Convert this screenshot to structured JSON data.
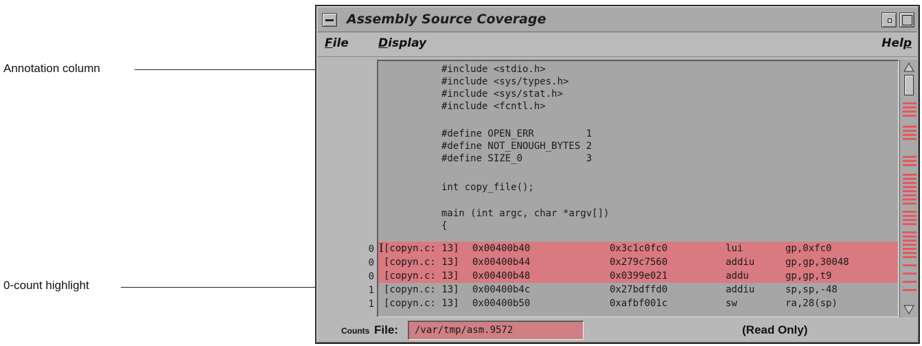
{
  "callouts": {
    "annotation_column": "Annotation column",
    "zero_count_highlight": "0-count highlight"
  },
  "window": {
    "title": "Assembly Source Coverage"
  },
  "menu": {
    "file": {
      "mnemonic": "F",
      "rest": "ile"
    },
    "display": {
      "mnemonic": "D",
      "rest": "isplay"
    },
    "help": {
      "rest": "Hel",
      "mnemonic": "p"
    }
  },
  "source_lines": [
    "#include <stdio.h>",
    "#include <sys/types.h>",
    "#include <sys/stat.h>",
    "#include <fcntl.h>",
    "",
    "#define OPEN_ERR         1",
    "#define NOT_ENOUGH_BYTES 2",
    "#define SIZE_0           3",
    "",
    "int copy_file();",
    "",
    "main (int argc, char *argv[])",
    "{"
  ],
  "asm_rows": [
    {
      "count": "0",
      "location": "[copyn.c: 13]",
      "address": "0x00400b40",
      "code": "0x3c1c0fc0",
      "op": "lui",
      "args": "gp,0xfc0",
      "highlight": true
    },
    {
      "count": "0",
      "location": "[copyn.c: 13]",
      "address": "0x00400b44",
      "code": "0x279c7560",
      "op": "addiu",
      "args": "gp,gp,30048",
      "highlight": true
    },
    {
      "count": "0",
      "location": "[copyn.c: 13]",
      "address": "0x00400b48",
      "code": "0x0399e021",
      "op": "addu",
      "args": "gp,gp,t9",
      "highlight": true
    },
    {
      "count": "1",
      "location": "[copyn.c: 13]",
      "address": "0x00400b4c",
      "code": "0x27bdffd0",
      "op": "addiu",
      "args": "sp,sp,-48",
      "highlight": false
    },
    {
      "count": "1",
      "location": "[copyn.c: 13]",
      "address": "0x00400b50",
      "code": "0xafbf001c",
      "op": "sw",
      "args": "ra,28(sp)",
      "highlight": false
    }
  ],
  "footer": {
    "counts_label": "Counts",
    "file_label": "File:",
    "file_value": "/var/tmp/asm.9572",
    "status": "(Read Only)"
  },
  "colors": {
    "highlight": "#d97a80",
    "scroll_marker": "#e8565d",
    "window_bg": "#b8b8b8",
    "pane_bg": "#a6a6a6"
  },
  "icons": {
    "window_menu": "window-menu-icon",
    "minimize": "minimize-icon",
    "maximize": "maximize-icon",
    "scroll_up": "arrow-up-icon",
    "scroll_down": "arrow-down-icon",
    "text_cursor": "i-beam-cursor-icon"
  }
}
